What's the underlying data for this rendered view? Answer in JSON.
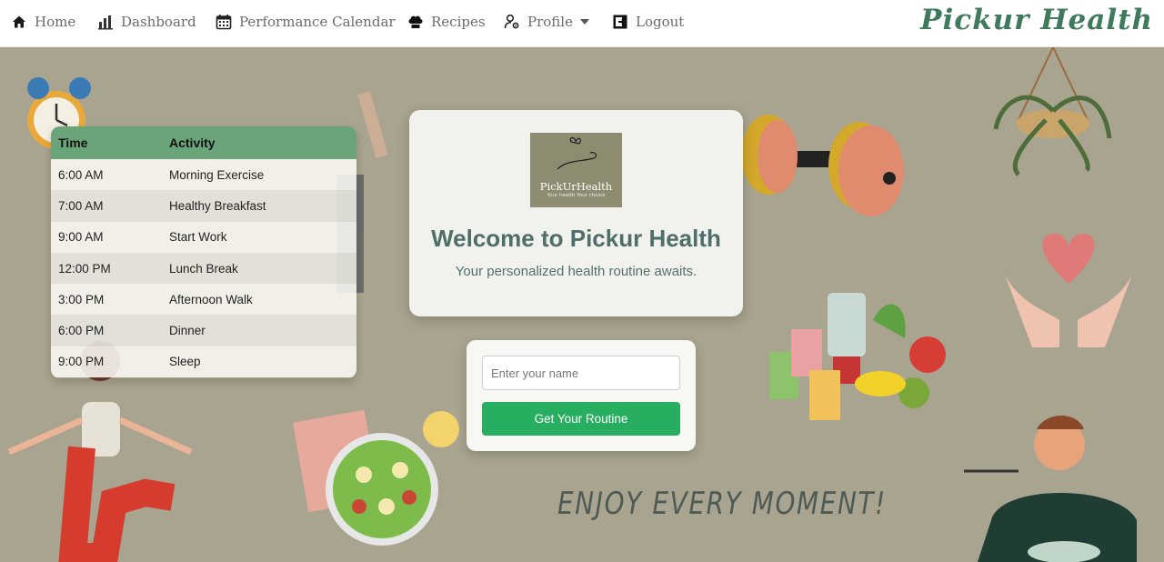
{
  "nav": {
    "items": [
      {
        "label": "Home",
        "icon": "home-icon"
      },
      {
        "label": "Dashboard",
        "icon": "bar-chart-icon"
      },
      {
        "label": "Performance Calendar",
        "icon": "calendar-icon"
      },
      {
        "label": "Recipes",
        "icon": "chef-hat-icon"
      },
      {
        "label": "Profile",
        "icon": "user-gear-icon"
      },
      {
        "label": "Logout",
        "icon": "logout-icon"
      }
    ],
    "brand": "Pickur Health"
  },
  "schedule": {
    "headers": [
      "Time",
      "Activity"
    ],
    "rows": [
      {
        "time": "6:00 AM",
        "activity": "Morning Exercise"
      },
      {
        "time": "7:00 AM",
        "activity": "Healthy Breakfast"
      },
      {
        "time": "9:00 AM",
        "activity": "Start Work"
      },
      {
        "time": "12:00 PM",
        "activity": "Lunch Break"
      },
      {
        "time": "3:00 PM",
        "activity": "Afternoon Walk"
      },
      {
        "time": "6:00 PM",
        "activity": "Dinner"
      },
      {
        "time": "9:00 PM",
        "activity": "Sleep"
      }
    ]
  },
  "welcome": {
    "logo_text": "PickUrHealth",
    "logo_tagline": "Your health Your choice",
    "title": "Welcome to Pickur Health",
    "subtitle": "Your personalized health routine awaits."
  },
  "form": {
    "name_placeholder": "Enter your name",
    "name_value": "",
    "submit_label": "Get Your Routine"
  },
  "tagline": "ENJOY EVERY MOMENT!",
  "colors": {
    "background": "#a8a48f",
    "table_header": "#6aa47a",
    "button": "#28ae60",
    "brand": "#3f7a5c",
    "heading": "#4f6e6a"
  }
}
